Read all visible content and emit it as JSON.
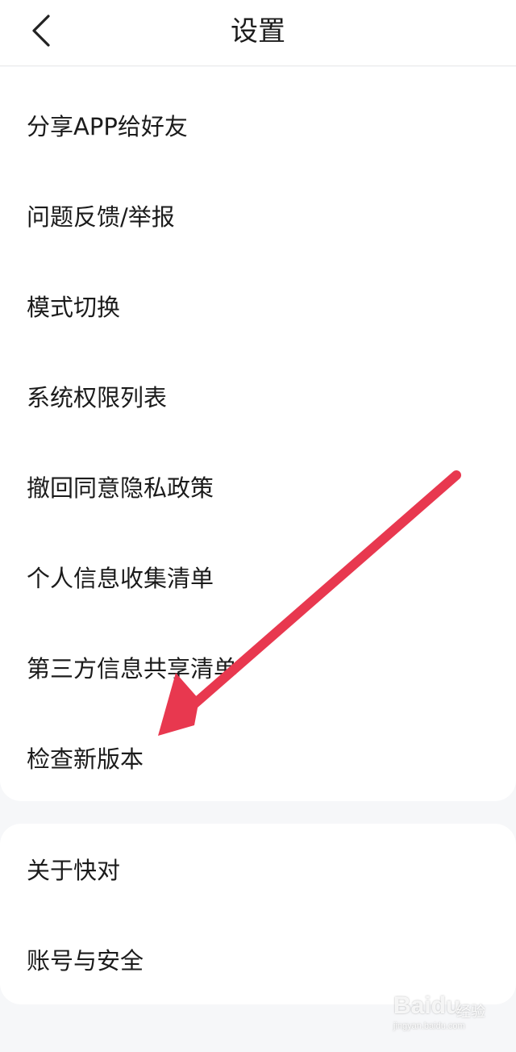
{
  "header": {
    "title": "设置",
    "back_icon": "chevron-left-icon"
  },
  "settings_group_1": [
    {
      "label": "分享APP给好友"
    },
    {
      "label": "问题反馈/举报"
    },
    {
      "label": "模式切换"
    },
    {
      "label": "系统权限列表"
    },
    {
      "label": "撤回同意隐私政策"
    },
    {
      "label": "个人信息收集清单"
    },
    {
      "label": "第三方信息共享清单"
    },
    {
      "label": "检查新版本"
    }
  ],
  "settings_group_2": [
    {
      "label": "关于快对"
    },
    {
      "label": "账号与安全"
    }
  ],
  "annotation": {
    "arrow_color": "#e8384f"
  },
  "watermark": {
    "brand": "Baidu",
    "suffix": "经验",
    "url": "jingyan.baidu.com"
  }
}
